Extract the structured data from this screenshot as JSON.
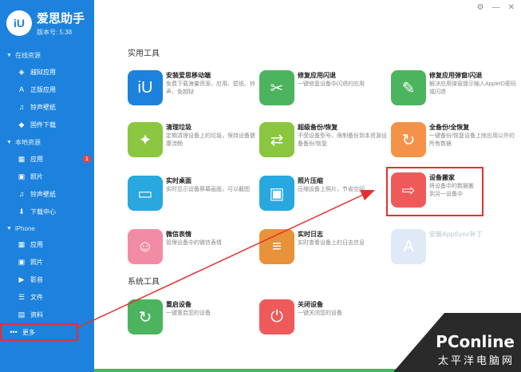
{
  "app": {
    "logo": "iU",
    "name": "爱思助手",
    "version": "版本号: 5.38"
  },
  "window_buttons": {
    "settings": "⚙",
    "minimize": "—",
    "close": "✕"
  },
  "sidebar": {
    "sections": [
      {
        "title": "在线资源",
        "items": [
          {
            "label": "越狱应用",
            "icon": "jailbreak-apps-icon"
          },
          {
            "label": "正版应用",
            "icon": "app-store-icon"
          },
          {
            "label": "铃声壁纸",
            "icon": "ringtone-icon"
          },
          {
            "label": "固件下载",
            "icon": "firmware-icon"
          }
        ]
      },
      {
        "title": "本地资源",
        "items": [
          {
            "label": "应用",
            "icon": "apps-icon",
            "badge": "1"
          },
          {
            "label": "照片",
            "icon": "photos-icon"
          },
          {
            "label": "铃声壁纸",
            "icon": "ringtone-icon"
          },
          {
            "label": "下载中心",
            "icon": "download-icon"
          }
        ]
      },
      {
        "title": "iPhone",
        "items": [
          {
            "label": "应用",
            "icon": "apps-icon"
          },
          {
            "label": "照片",
            "icon": "photos-icon"
          },
          {
            "label": "影音",
            "icon": "media-icon"
          },
          {
            "label": "文件",
            "icon": "files-icon"
          },
          {
            "label": "资料",
            "icon": "info-icon"
          },
          {
            "label": "更多",
            "icon": "more-icon"
          }
        ]
      }
    ]
  },
  "main": {
    "utility_title": "实用工具",
    "system_title": "系统工具",
    "tools": [
      {
        "name": "安装爱思移动端",
        "desc": "免费下载海量资源，应用、壁纸、铃声、免越狱",
        "color": "#1c82dd",
        "glyph": "iU"
      },
      {
        "name": "修复应用闪退",
        "desc": "一键修复设备中闪退的应用",
        "color": "#4cb45f",
        "glyph": "✂"
      },
      {
        "name": "修复应用弹窗/闪退",
        "desc": "解决应用弹窗提示输入AppleID密码或闪退",
        "color": "#4cb45f",
        "glyph": "✎"
      },
      {
        "name": "清理垃圾",
        "desc": "定期清理设备上的垃圾，保持设备健康流畅",
        "color": "#8ac640",
        "glyph": "✦"
      },
      {
        "name": "超级备份/恢复",
        "desc": "不受设备型号、限制备份到本资源设备备份/恢复",
        "color": "#8ac640",
        "glyph": "⇄"
      },
      {
        "name": "全备份/全恢复",
        "desc": "一键备份/恢复设备上除应用以外的所有数据",
        "color": "#f5924a",
        "glyph": "↻"
      },
      {
        "name": "实时桌面",
        "desc": "实时显示设备屏幕画面，可以截图",
        "color": "#29a8e0",
        "glyph": "▭"
      },
      {
        "name": "照片压缩",
        "desc": "压缩设备上照片，节省空间",
        "color": "#29a8e0",
        "glyph": "▣"
      },
      {
        "name": "设备搬家",
        "desc": "将设备中的数据搬到另一设备中",
        "color": "#ee5a5a",
        "glyph": "⇨"
      },
      {
        "name": "微信表情",
        "desc": "管理设备中的微信表情",
        "color": "#f28ca4",
        "glyph": "☺"
      },
      {
        "name": "实时日志",
        "desc": "实时查看设备上的日志信息",
        "color": "#e8923a",
        "glyph": "≡"
      },
      {
        "name": "安装AppSync补丁",
        "desc": "",
        "color": "#c6daf0",
        "glyph": "A"
      }
    ],
    "system_tools": [
      {
        "name": "重启设备",
        "desc": "一键重启您的设备",
        "color": "#4cb45f",
        "glyph": "↻"
      },
      {
        "name": "关闭设备",
        "desc": "一键关闭您的设备",
        "color": "#ee5a5a",
        "glyph": "⏻"
      }
    ]
  },
  "watermark": {
    "brand": "PConline",
    "sub": "太平洋电脑网"
  }
}
